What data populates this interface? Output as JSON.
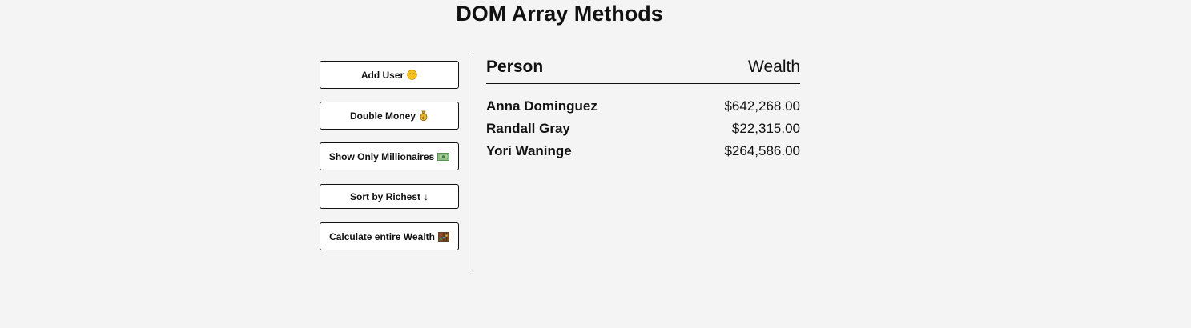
{
  "page": {
    "title": "DOM Array Methods"
  },
  "actions": [
    {
      "label": "Add User",
      "icon": "face-icon",
      "glyph": "😶"
    },
    {
      "label": "Double Money",
      "icon": "money-bag-icon",
      "glyph": "💰"
    },
    {
      "label": "Show Only Millionaires",
      "icon": "dollar-banknote-icon",
      "glyph": "💵"
    },
    {
      "label": "Sort by Richest",
      "icon": "arrow-down-icon",
      "glyph": "↓"
    },
    {
      "label": "Calculate entire Wealth",
      "icon": "abacus-icon",
      "glyph": "🧮"
    }
  ],
  "table": {
    "header_person": "Person",
    "header_wealth": "Wealth",
    "rows": [
      {
        "name": "Anna Dominguez",
        "money": "$642,268.00"
      },
      {
        "name": "Randall Gray",
        "money": "$22,315.00"
      },
      {
        "name": "Yori Waninge",
        "money": "$264,586.00"
      }
    ]
  },
  "colors": {
    "background": "#f4f4f4",
    "button_background": "#ffffff",
    "border": "#111111",
    "text": "#111111"
  }
}
